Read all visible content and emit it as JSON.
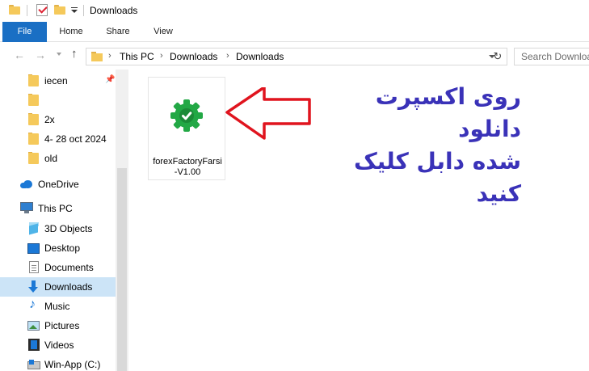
{
  "window": {
    "title": "Downloads"
  },
  "ribbon": {
    "tabs": [
      "File",
      "Home",
      "Share",
      "View"
    ]
  },
  "address": {
    "breadcrumbs": [
      "This PC",
      "Downloads",
      "Downloads"
    ],
    "search_placeholder": "Search Downloads"
  },
  "sidebar": {
    "quick_access": [
      {
        "label": "iecen",
        "icon": "folder-icon",
        "pinned": true
      },
      {
        "label": "",
        "icon": "folder-icon"
      },
      {
        "label": "2x",
        "icon": "folder-icon"
      },
      {
        "label": "4- 28 oct 2024",
        "icon": "folder-icon"
      },
      {
        "label": "old",
        "icon": "folder-icon"
      }
    ],
    "onedrive": "OneDrive",
    "this_pc": "This PC",
    "pc_items": [
      {
        "label": "3D Objects",
        "icon": "3d-objects-icon"
      },
      {
        "label": "Desktop",
        "icon": "desktop-icon"
      },
      {
        "label": "Documents",
        "icon": "documents-icon"
      },
      {
        "label": "Downloads",
        "icon": "downloads-icon",
        "selected": true
      },
      {
        "label": "Music",
        "icon": "music-icon"
      },
      {
        "label": "Pictures",
        "icon": "pictures-icon"
      },
      {
        "label": "Videos",
        "icon": "videos-icon"
      },
      {
        "label": "Win-App (C:)",
        "icon": "drive-icon"
      }
    ]
  },
  "content": {
    "files": [
      {
        "name_line1": "forexFactoryFarsi",
        "name_line2": "-V1.00",
        "icon": "green-gear-check-icon"
      }
    ],
    "annotation": {
      "line1": "روی اکسپرت دانلود",
      "line2": "شده دابل کلیک کنید",
      "color": "#3a32b8"
    },
    "arrow_color": "#e0141e"
  },
  "colors": {
    "accent": "#1a6fc4",
    "selected_bg": "#cce4f7"
  }
}
